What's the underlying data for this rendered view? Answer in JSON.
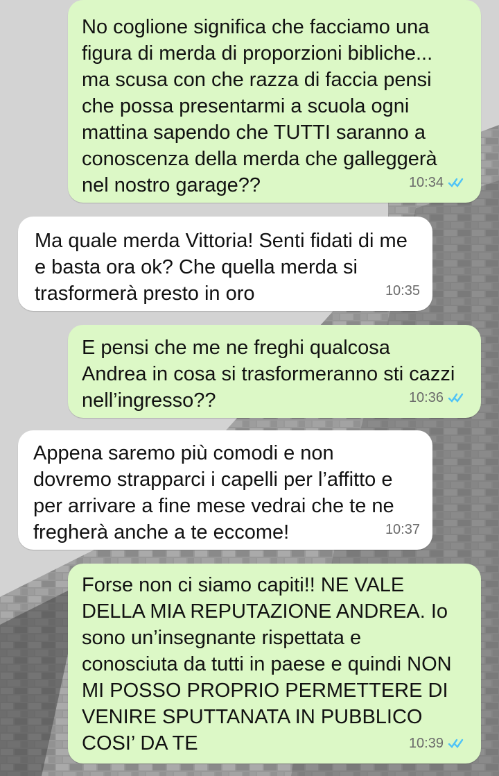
{
  "colors": {
    "outgoing_bubble": "#dcf8c6",
    "incoming_bubble": "#ffffff",
    "read_ticks": "#4fc3f7"
  },
  "messages": [
    {
      "direction": "outgoing",
      "text": "No coglione significa che facciamo una\nfigura di merda di proporzioni bibliche...\nma scusa con che razza di faccia pensi\nche possa presentarmi a scuola ogni\nmattina sapendo che TUTTI saranno a\nconoscenza della merda che galleggerà\nnel nostro garage??",
      "time": "10:34",
      "status_icon": "double-check-read-icon"
    },
    {
      "direction": "incoming",
      "text": "Ma quale merda Vittoria! Senti fidati di me\ne basta ora ok? Che quella merda si\ntrasformerà presto in oro",
      "time": "10:35"
    },
    {
      "direction": "outgoing",
      "text": "E pensi che me ne freghi qualcosa\nAndrea in cosa si trasformeranno sti cazzi\nnell’ingresso??",
      "time": "10:36",
      "status_icon": "double-check-read-icon"
    },
    {
      "direction": "incoming",
      "text": "Appena saremo più comodi e non\ndovremo strapparci i capelli per l’affitto e\nper arrivare a fine mese vedrai che te ne\nfregherà anche a te eccome!",
      "time": "10:37"
    },
    {
      "direction": "outgoing",
      "text": "Forse non ci siamo capiti!! NE VALE\nDELLA MIA REPUTAZIONE ANDREA. Io\nsono un’insegnante rispettata e\nconosciuta da tutti in paese e quindi NON\nMI POSSO PROPRIO PERMETTERE DI\nVENIRE SPUTTANATA IN PUBBLICO\nCOSI’ DA TE",
      "time": "10:39",
      "status_icon": "double-check-read-icon"
    }
  ]
}
